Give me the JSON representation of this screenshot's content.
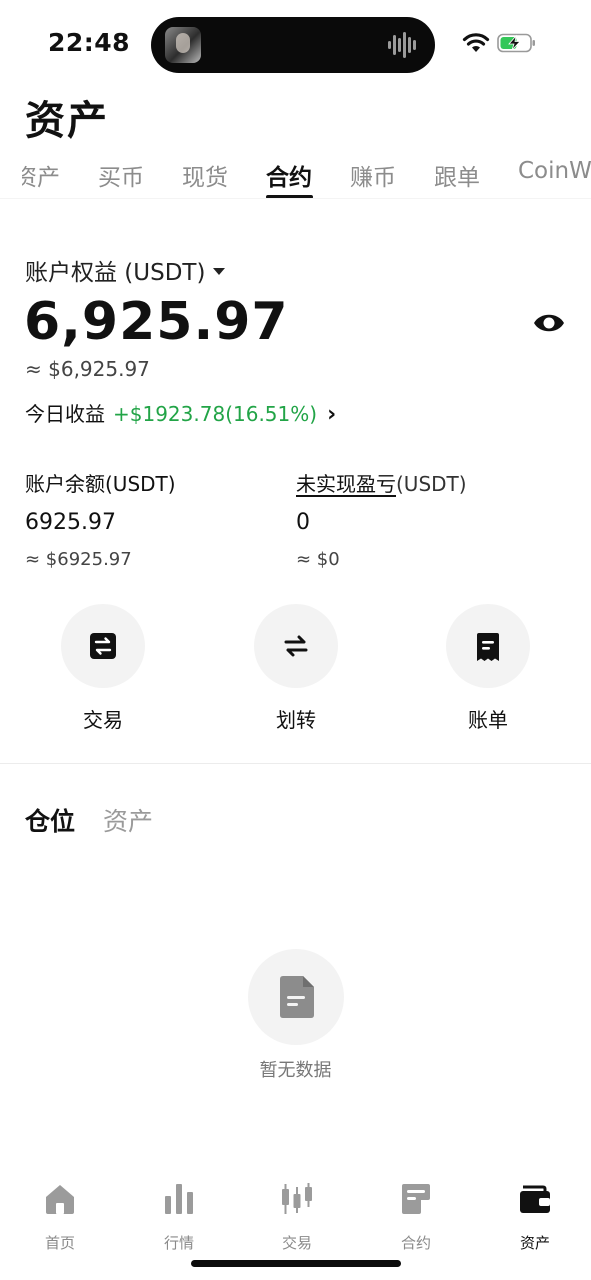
{
  "status_bar": {
    "time": "22:48"
  },
  "header": {
    "title": "资产"
  },
  "tabs": [
    {
      "label": "资产",
      "active": false
    },
    {
      "label": "买币",
      "active": false
    },
    {
      "label": "现货",
      "active": false
    },
    {
      "label": "合约",
      "active": true
    },
    {
      "label": "赚币",
      "active": false
    },
    {
      "label": "跟单",
      "active": false
    },
    {
      "label": "CoinW",
      "active": false
    }
  ],
  "equity": {
    "label": "账户权益 (USDT)",
    "value": "6,925.97",
    "fiat": "≈ $6,925.97",
    "today_label": "今日收益",
    "today_value": "+$1923.78(16.51%)",
    "chevron": "›"
  },
  "balance": {
    "label": "账户余额(USDT)",
    "value": "6925.97",
    "fiat": "≈ $6925.97"
  },
  "unrealized": {
    "label_underlined": "未实现盈亏",
    "label_suffix": "(USDT)",
    "value": "0",
    "fiat": "≈ $0"
  },
  "actions": [
    {
      "label": "交易",
      "icon": "swap-box-icon"
    },
    {
      "label": "划转",
      "icon": "transfer-icon"
    },
    {
      "label": "账单",
      "icon": "bill-icon"
    }
  ],
  "positions": {
    "tab_active": "仓位",
    "tab_inactive": "资产",
    "empty_text": "暂无数据"
  },
  "bottom_nav": [
    {
      "label": "首页",
      "icon": "home-icon",
      "active": false
    },
    {
      "label": "行情",
      "icon": "market-bars-icon",
      "active": false
    },
    {
      "label": "交易",
      "icon": "candlestick-icon",
      "active": false
    },
    {
      "label": "合约",
      "icon": "contract-icon",
      "active": false
    },
    {
      "label": "资产",
      "icon": "wallet-icon",
      "active": true
    }
  ],
  "colors": {
    "positive": "#22a447",
    "muted": "#8c8c8c",
    "icon_inactive": "#9b9b9b",
    "surface": "#f3f3f3"
  }
}
